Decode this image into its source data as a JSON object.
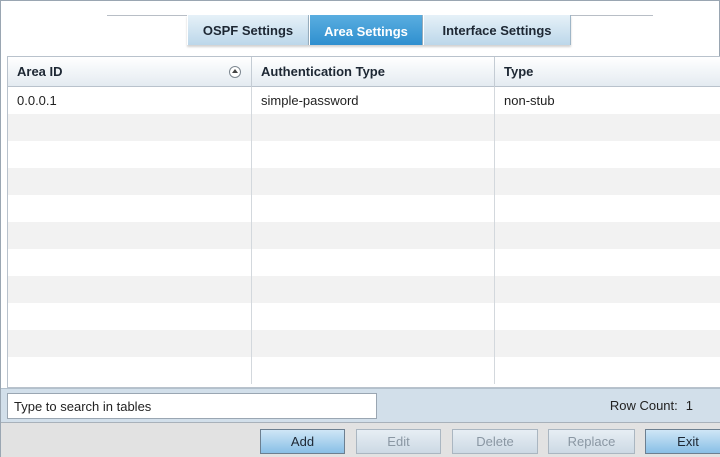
{
  "tabs": [
    {
      "label": "OSPF Settings",
      "active": false
    },
    {
      "label": "Area Settings",
      "active": true
    },
    {
      "label": "Interface Settings",
      "active": false
    }
  ],
  "table": {
    "columns": [
      "Area ID",
      "Authentication Type",
      "Type"
    ],
    "rows": [
      [
        "0.0.0.1",
        "simple-password",
        "non-stub"
      ]
    ]
  },
  "search": {
    "placeholder": "Type to search in tables"
  },
  "row_count": {
    "label": "Row Count:",
    "value": "1"
  },
  "buttons": {
    "add": "Add",
    "edit": "Edit",
    "delete": "Delete",
    "replace": "Replace",
    "exit": "Exit"
  },
  "colors": {
    "active_tab": "#2f8fcf",
    "status_bar": "#d2dfea"
  },
  "icons": {
    "sort": "sort-icon"
  }
}
